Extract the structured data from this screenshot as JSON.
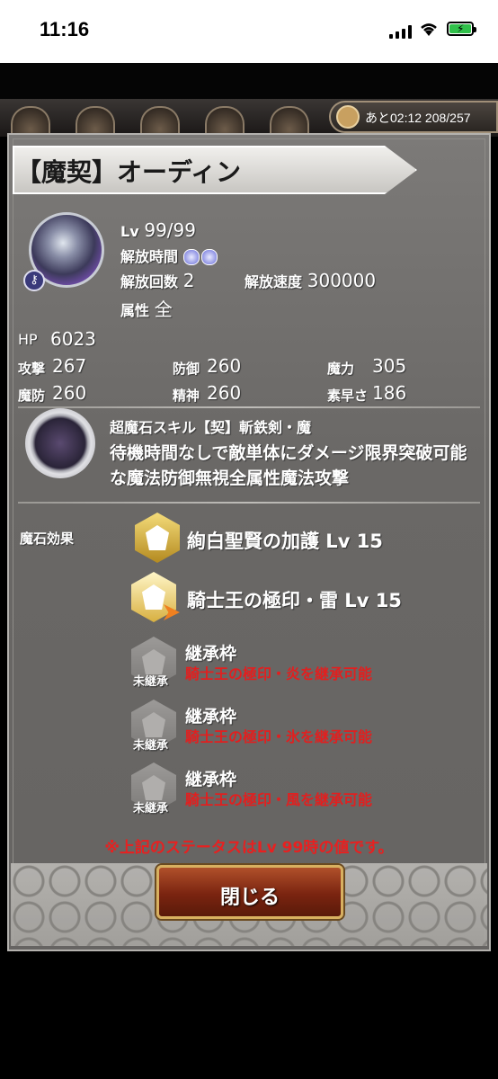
{
  "status_bar": {
    "time": "11:16"
  },
  "header": {
    "stamina_timer": "あと02:12 208/257"
  },
  "title": "【魔契】オーディン",
  "unit": {
    "level_label": "Lv",
    "level_value": "99/99",
    "release_time_label": "解放時間",
    "release_count_label": "解放回数",
    "release_count_value": "2",
    "release_speed_label": "解放速度",
    "release_speed_value": "300000",
    "element_label": "属性",
    "element_value": "全"
  },
  "stats": {
    "hp_label": "HP",
    "hp_value": "6023",
    "atk_label": "攻撃",
    "atk_value": "267",
    "def_label": "防御",
    "def_value": "260",
    "mag_label": "魔力",
    "mag_value": "305",
    "mdef_label": "魔防",
    "mdef_value": "260",
    "spr_label": "精神",
    "spr_value": "260",
    "spd_label": "素早さ",
    "spd_value": "186"
  },
  "skill": {
    "heading": "超魔石スキル【契】斬鉄剣・魔",
    "description": "待機時間なしで敵単体にダメージ限界突破可能な魔法防御無視全属性魔法攻撃"
  },
  "effects": {
    "label": "魔石効果",
    "items": [
      {
        "name": "絢白聖賢の加護 Lv 15"
      },
      {
        "name": "騎士王の極印・雷 Lv 15"
      }
    ],
    "inherit_slots": [
      {
        "title": "継承枠",
        "note": "騎士王の極印・炎を継承可能",
        "status": "未継承"
      },
      {
        "title": "継承枠",
        "note": "騎士王の極印・氷を継承可能",
        "status": "未継承"
      },
      {
        "title": "継承枠",
        "note": "騎士王の極印・風を継承可能",
        "status": "未継承"
      }
    ]
  },
  "footnote": "※上記のステータスはLv 99時の値です。",
  "close_button": "閉じる",
  "colors": {
    "accent_red": "#e02020",
    "button": "#7a2410",
    "button_border": "#d8b060"
  }
}
